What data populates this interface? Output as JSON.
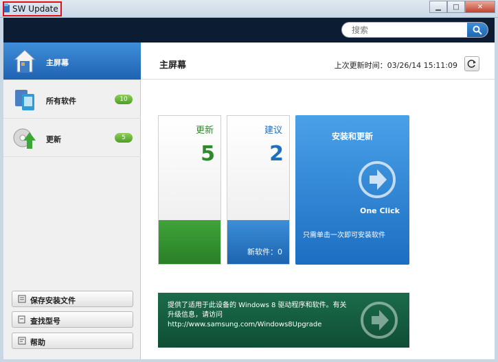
{
  "window": {
    "title": "SW Update"
  },
  "search": {
    "placeholder": "搜索"
  },
  "sidebar": {
    "items": [
      {
        "label": "主屏幕",
        "icon": "home-icon",
        "active": true
      },
      {
        "label": "所有软件",
        "icon": "all-software-icon",
        "badge": "10"
      },
      {
        "label": "更新",
        "icon": "update-icon",
        "badge": "5"
      }
    ],
    "buttons": [
      {
        "label": "保存安装文件",
        "icon": "save-icon"
      },
      {
        "label": "查找型号",
        "icon": "find-icon"
      },
      {
        "label": "帮助",
        "icon": "help-icon"
      }
    ]
  },
  "main": {
    "title": "主屏幕",
    "last_update": "上次更新时间：03/26/14  15:11:09",
    "tiles": {
      "update": {
        "label": "更新",
        "count": "5"
      },
      "recommend": {
        "label": "建议",
        "count": "2",
        "new_software": "新软件：0"
      },
      "install": {
        "title": "安装和更新",
        "one_click": "One Click",
        "desc": "只需单击一次即可安装软件"
      }
    },
    "banner": {
      "text": "提供了适用于此设备的 Windows 8 驱动程序和软件。有关升级信息，请访问\nhttp://www.samsung.com/Windows8Upgrade"
    }
  },
  "colors": {
    "accent": "#1f63b3",
    "update_green": "#2f8a2a",
    "banner": "#0f4e35"
  }
}
